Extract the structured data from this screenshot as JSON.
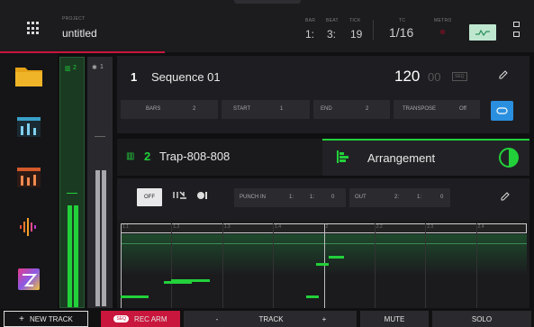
{
  "header": {
    "project_label": "PROJECT",
    "project_name": "untitled",
    "bar_label": "BAR",
    "bar_value": "1:",
    "beat_label": "BEAT",
    "beat_value": "3:",
    "tick_label": "TICK",
    "tick_value": "19",
    "tc_label": "TC",
    "tc_value": "1/16",
    "metro_label": "METRO"
  },
  "sequence": {
    "number": "1",
    "name": "Sequence 01",
    "bpm": "120",
    "bpm_decimal": "00",
    "seq_badge": "SEQ",
    "fields": [
      {
        "label": "BARS",
        "value": "2"
      },
      {
        "label": "START",
        "value": "1"
      },
      {
        "label": "END",
        "value": "2"
      },
      {
        "label": "TRANSPOSE",
        "value": "Off"
      }
    ]
  },
  "mixer": {
    "strip1_num": "2",
    "strip2_num": "1"
  },
  "track": {
    "number": "2",
    "name": "Trap-808-808",
    "arrangement_label": "Arrangement"
  },
  "record": {
    "off_label": "OFF",
    "punch_in_label": "PUNCH IN",
    "punch_in": [
      "1:",
      "1:",
      "0"
    ],
    "out_label": "OUT",
    "out": [
      "2:",
      "1:",
      "0"
    ]
  },
  "timeline": {
    "ticks": [
      "1.1",
      "1.2",
      "1.3",
      "1.4",
      "2",
      "2.2",
      "2.3",
      "2.4"
    ]
  },
  "notes": [
    {
      "start_beat": 0.0,
      "length_beats": 0.55,
      "pitch_row": 0
    },
    {
      "start_beat": 0.85,
      "length_beats": 0.55,
      "pitch_row": 2
    },
    {
      "start_beat": 1.0,
      "length_beats": 0.75,
      "pitch_row": 1
    },
    {
      "start_beat": 3.65,
      "length_beats": 0.25,
      "pitch_row": 0
    },
    {
      "start_beat": 3.85,
      "length_beats": 0.25,
      "pitch_row": 3
    },
    {
      "start_beat": 4.1,
      "length_beats": 0.3,
      "pitch_row": 4
    }
  ],
  "bottombar": {
    "new_track": "NEW TRACK",
    "rec_arm_badge": "SEQ",
    "rec_arm": "REC ARM",
    "minus": "-",
    "track": "TRACK",
    "plus": "+",
    "mute": "MUTE",
    "solo": "SOLO"
  },
  "colors": {
    "accent_red": "#c8163c",
    "accent_green": "#22d13a",
    "accent_blue": "#2b8fe0"
  }
}
